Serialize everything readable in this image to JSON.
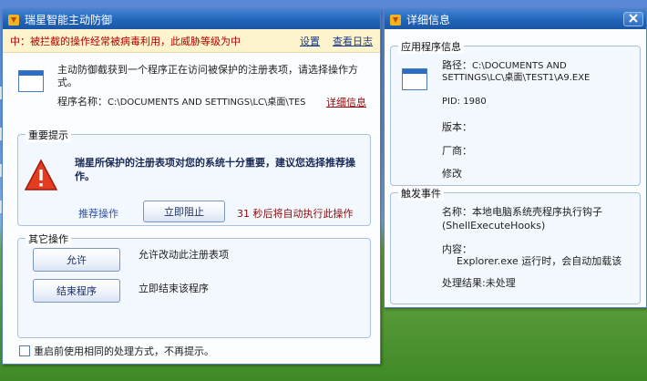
{
  "main_window": {
    "title": "瑞星智能主动防御",
    "warning": {
      "text": "中：被拦截的操作经常被病毒利用，此威胁等级为中",
      "settings_link": "设置",
      "log_link": "查看日志"
    },
    "description": "主动防御截获到一个程序正在访问被保护的注册表项，请选择操作方式。",
    "program_label": "程序名称：",
    "program_value": "C:\\DOCUMENTS AND SETTINGS\\LC\\桌面\\TES",
    "details_link": "详细信息",
    "important": {
      "legend": "重要提示",
      "message": "瑞星所保护的注册表项对您的系统十分重要，建议您选择推荐操作。",
      "recommend_label": "推荐操作",
      "block_button": "立即阻止",
      "countdown": "31 秒后将自动执行此操作"
    },
    "other": {
      "legend": "其它操作",
      "allow_button": "允许",
      "allow_desc": "允许改动此注册表项",
      "end_button": "结束程序",
      "end_desc": "立即结束该程序"
    },
    "remember_checkbox_label": "重启前使用相同的处理方式，不再提示。"
  },
  "detail_window": {
    "title": "详细信息",
    "app_info": {
      "legend": "应用程序信息",
      "path_label": "路径：",
      "path_value": "C:\\DOCUMENTS AND SETTINGS\\LC\\桌面\\TEST1\\A9.EXE",
      "pid": "PID: 1980",
      "version_label": "版本：",
      "vendor_label": "厂商：",
      "modify_label": "修改"
    },
    "trigger": {
      "legend": "触发事件",
      "name_label": "名称：",
      "name_value": "本地电脑系统壳程序执行钩子(ShellExecuteHooks)",
      "content_label": "内容：",
      "content_value": "Explorer.exe 运行时，会自动加载该",
      "result": "处理结果:未处理"
    }
  },
  "colors": {
    "titlebar": "#2163b8",
    "warning_text": "#b00000",
    "link": "#1a3c88",
    "countdown": "#8b0a0a"
  }
}
